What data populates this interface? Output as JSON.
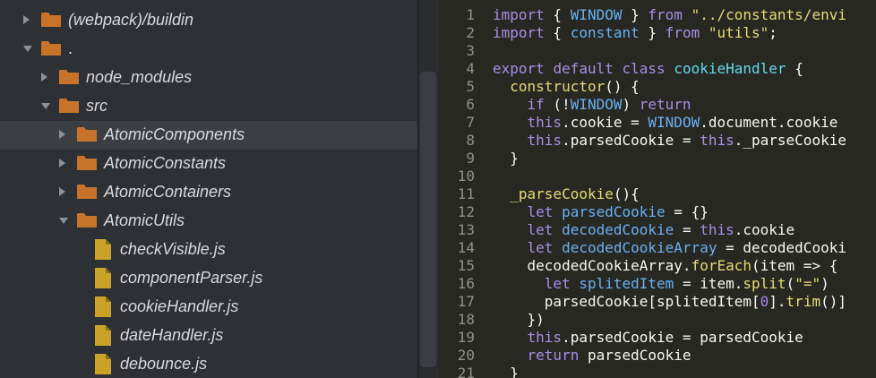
{
  "sidebar": {
    "items": [
      {
        "label": "(webpack)/buildin",
        "kind": "folder",
        "state": "closed"
      },
      {
        "label": ".",
        "kind": "folder",
        "state": "open"
      },
      {
        "label": "node_modules",
        "kind": "folder",
        "state": "closed"
      },
      {
        "label": "src",
        "kind": "folder",
        "state": "open"
      },
      {
        "label": "AtomicComponents",
        "kind": "folder",
        "state": "closed",
        "selected": true
      },
      {
        "label": "AtomicConstants",
        "kind": "folder",
        "state": "closed"
      },
      {
        "label": "AtomicContainers",
        "kind": "folder",
        "state": "closed"
      },
      {
        "label": "AtomicUtils",
        "kind": "folder",
        "state": "open"
      },
      {
        "label": "checkVisible.js",
        "kind": "file"
      },
      {
        "label": "componentParser.js",
        "kind": "file"
      },
      {
        "label": "cookieHandler.js",
        "kind": "file"
      },
      {
        "label": "dateHandler.js",
        "kind": "file"
      },
      {
        "label": "debounce.js",
        "kind": "file"
      }
    ]
  },
  "editor": {
    "line_numbers": [
      "1",
      "2",
      "3",
      "4",
      "5",
      "6",
      "7",
      "8",
      "9",
      "10",
      "11",
      "12",
      "13",
      "14",
      "15",
      "16",
      "17",
      "18",
      "19",
      "20",
      "21"
    ],
    "lines": [
      "import { WINDOW } from \"../constants/envi",
      "import { constant } from \"utils\";",
      "",
      "export default class cookieHandler {",
      "  constructor() {",
      "    if (!WINDOW) return",
      "    this.cookie = WINDOW.document.cookie",
      "    this.parsedCookie = this._parseCookie",
      "  }",
      "",
      "  _parseCookie(){",
      "    let parsedCookie = {}",
      "    let decodedCookie = this.cookie",
      "    let decodedCookieArray = decodedCooki",
      "    decodedCookieArray.forEach(item => {",
      "      let splitedItem = item.split(\"=\")",
      "      parsedCookie[splitedItem[0].trim()]",
      "    })",
      "    this.parsedCookie = parsedCookie",
      "    return parsedCookie",
      "  }"
    ]
  },
  "colors": {
    "sidebar_bg": "#2d3034",
    "editor_bg": "#272822",
    "folder": "#c8732a",
    "file": "#c9a227",
    "selected_row": "#3b3f44"
  }
}
